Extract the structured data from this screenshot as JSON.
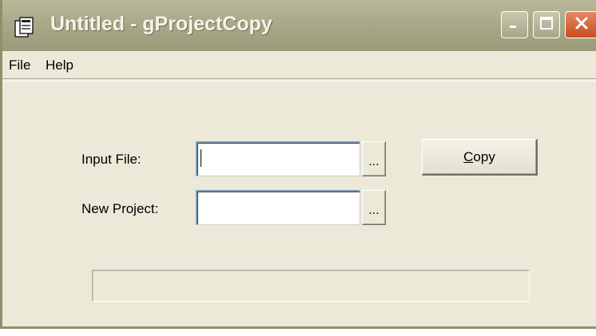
{
  "window": {
    "title": "Untitled - gProjectCopy",
    "app_icon": "app-icon",
    "controls": {
      "minimize_icon": "minimize-icon",
      "maximize_icon": "maximize-icon",
      "close_icon": "close-icon"
    }
  },
  "menu": {
    "items": [
      {
        "label": "File"
      },
      {
        "label": "Help"
      }
    ]
  },
  "form": {
    "input_file": {
      "label": "Input File:",
      "value": "",
      "browse_label": "..."
    },
    "new_project": {
      "label": "New Project:",
      "value": "",
      "browse_label": "..."
    },
    "copy_button": {
      "mnemonic": "C",
      "label_rest": "opy"
    }
  },
  "progress": {
    "value": 0
  },
  "colors": {
    "titlebar": "#a9a989",
    "face": "#ece9d8",
    "close": "#c84b1e"
  }
}
